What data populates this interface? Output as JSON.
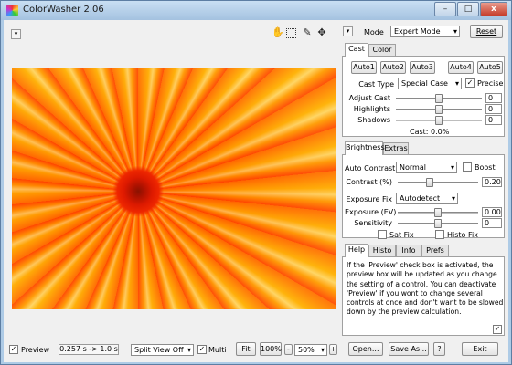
{
  "app": {
    "title": "ColorWasher 2.06"
  },
  "window": {
    "minimize": "–",
    "restore": "□",
    "close": "x"
  },
  "toolbar": {
    "menu_chevron": "▾",
    "hand_icon": "hand-icon",
    "marquee_icon": "marquee-select-icon",
    "eyedropper_icon": "eyedropper-icon",
    "move_icon": "move-icon"
  },
  "right_header": {
    "chevron": "▾",
    "mode_label": "Mode",
    "mode_value": "Expert Mode",
    "reset_label": "Reset"
  },
  "cast": {
    "tabs": [
      "Cast",
      "Color"
    ],
    "auto_buttons": [
      "Auto1",
      "Auto2",
      "Auto3",
      "Auto4",
      "Auto5"
    ],
    "cast_type_label": "Cast Type",
    "cast_type_value": "Special Case",
    "precise_label": "Precise",
    "precise_checked": true,
    "adjust_cast_label": "Adjust Cast",
    "adjust_cast_value": "0",
    "adjust_cast_level": 0.5,
    "highlights_label": "Highlights",
    "highlights_value": "0",
    "highlights_level": 0.5,
    "shadows_label": "Shadows",
    "shadows_value": "0",
    "shadows_level": 0.5,
    "status": "Cast: 0.0%"
  },
  "brightness": {
    "tabs": [
      "Brightness",
      "Extras"
    ],
    "auto_contrast_label": "Auto Contrast",
    "auto_contrast_value": "Normal",
    "boost_label": "Boost",
    "boost_checked": false,
    "contrast_label": "Contrast (%)",
    "contrast_value": "0.20",
    "contrast_level": 0.4,
    "exposure_fix_label": "Exposure Fix",
    "exposure_fix_value": "Autodetect",
    "exposure_ev_label": "Exposure (EV)",
    "exposure_ev_value": "0.00",
    "exposure_ev_level": 0.5,
    "sensitivity_label": "Sensitivity",
    "sensitivity_value": "0",
    "sensitivity_level": 0.5,
    "sat_fix_label": "Sat Fix",
    "sat_fix_checked": false,
    "histo_fix_label": "Histo Fix",
    "histo_fix_checked": false
  },
  "help": {
    "tabs": [
      "Help",
      "Histo",
      "Info",
      "Prefs"
    ],
    "text": "If the 'Preview' check box is activated, the preview box will be updated as you change the setting of a control. You can deactivate 'Preview' if you wont to change several controls at once and don't want to be slowed down by the preview calculation.",
    "check": "✓"
  },
  "bottom": {
    "preview_label": "Preview",
    "preview_checked": true,
    "timing": "0.257 s -> 1.0 s",
    "split_view_value": "Split View Off",
    "multi_label": "Multi",
    "multi_checked": true,
    "fit_label": "Fit",
    "zoom_100_label": "100%",
    "zoom_minus": "-",
    "zoom_value": "50%",
    "zoom_plus": "+",
    "open_label": "Open...",
    "save_as_label": "Save As...",
    "help_label": "?",
    "exit_label": "Exit"
  }
}
